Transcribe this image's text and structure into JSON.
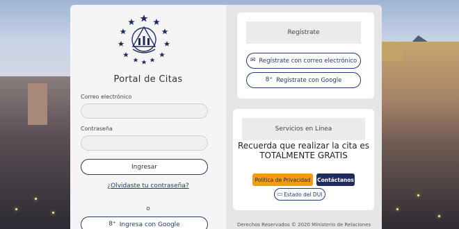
{
  "login": {
    "title": "Portal de Citas",
    "email_label": "Correo electrónico",
    "email_value": "",
    "password_label": "Contraseña",
    "password_value": "",
    "submit_label": "Ingresar",
    "forgot_label": "¿Olvidaste tu contraseña?",
    "or_label": "o",
    "google_label": "Ingresa con Google"
  },
  "register": {
    "heading": "Regístrate",
    "email_button": "Regístrate con correo electrónico",
    "google_button": "Regístrate con Google"
  },
  "services": {
    "heading": "Servicios en Línea",
    "message_line1": "Recuerda que realizar la cita es",
    "message_line2": "TOTALMENTE GRATIS",
    "privacy_label": "Política de Privacidad",
    "contact_label": "Contáctanos",
    "dui_label": "Estado del DUI"
  },
  "footer": {
    "text": "Derechos Reservados © 2020 Ministerio de Relaciones"
  },
  "icons": {
    "email_icon": "envelope-icon",
    "google_icon": "google-g-icon",
    "dui_icon": "id-card-icon"
  },
  "colors": {
    "primary": "#233a6b",
    "privacy": "#f39c12",
    "contact": "#1f2b5e"
  }
}
